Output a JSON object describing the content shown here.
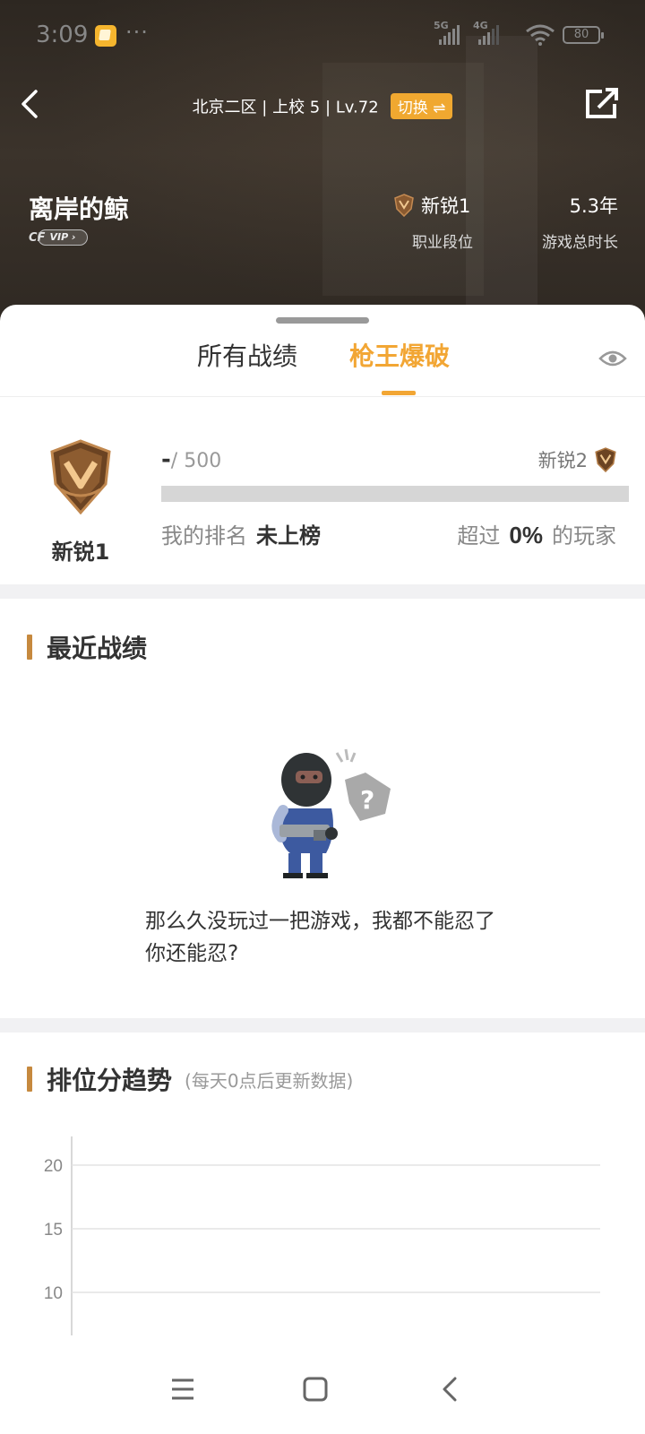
{
  "status_bar": {
    "time": "3:09",
    "dots": "···",
    "signal1": "5G",
    "signal2": "4G",
    "battery": "80"
  },
  "header": {
    "server_info": "北京二区 | 上校 5 | Lv.72",
    "switch_label": "切换 ⇌",
    "nickname": "离岸的鲸",
    "vip_label": "VIP",
    "vip_mark": "CF",
    "rank_value": "新锐1",
    "rank_label": "职业段位",
    "playtime_value": "5.3年",
    "playtime_label": "游戏总时长"
  },
  "tabs": {
    "all": "所有战绩",
    "king": "枪王爆破",
    "active": "king"
  },
  "rank_card": {
    "rank_name": "新锐1",
    "score_current": "-",
    "score_total": "/ 500",
    "next_rank": "新锐2",
    "progress_fraction": 0,
    "my_rank_label": "我的排名",
    "my_rank_value": "未上榜",
    "beat_prefix": "超过",
    "beat_value": "0%",
    "beat_suffix": "的玩家"
  },
  "recent": {
    "title": "最近战绩",
    "empty_message": "那么久没玩过一把游戏，我都不能忍了你还能忍?"
  },
  "trend": {
    "title": "排位分趋势",
    "subtitle": "(每天0点后更新数据)"
  },
  "chart_data": {
    "type": "line",
    "title": "",
    "xlabel": "",
    "ylabel": "",
    "y_ticks": [
      20,
      15,
      10
    ],
    "series": [],
    "grid": true
  },
  "colors": {
    "accent": "#f2a634",
    "section_bar": "#c6893e",
    "hero_bg": "#2e2822"
  },
  "nav": {
    "menu_icon": "menu-icon",
    "home_icon": "home-icon",
    "back_icon": "back-icon"
  }
}
